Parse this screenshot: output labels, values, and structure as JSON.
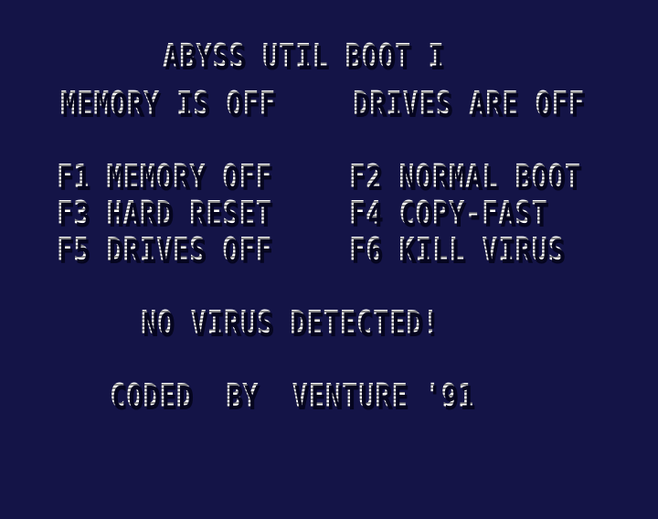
{
  "screen": {
    "background": "#141447",
    "text_color": "#ffffff",
    "shadow_color": "#05051f"
  },
  "header": {
    "title": "ABYSS UTIL BOOT I"
  },
  "status": {
    "memory": "MEMORY IS OFF",
    "drives": "DRIVES ARE OFF"
  },
  "menu": {
    "f1": "F1 MEMORY OFF",
    "f2": "F2 NORMAL BOOT",
    "f3": "F3 HARD RESET",
    "f4": "F4 COPY-FAST",
    "f5": "F5 DRIVES OFF",
    "f6": "F6 KILL VIRUS"
  },
  "message": {
    "virus_status": "NO VIRUS DETECTED!"
  },
  "footer": {
    "credits": "CODED  BY  VENTURE '91"
  }
}
